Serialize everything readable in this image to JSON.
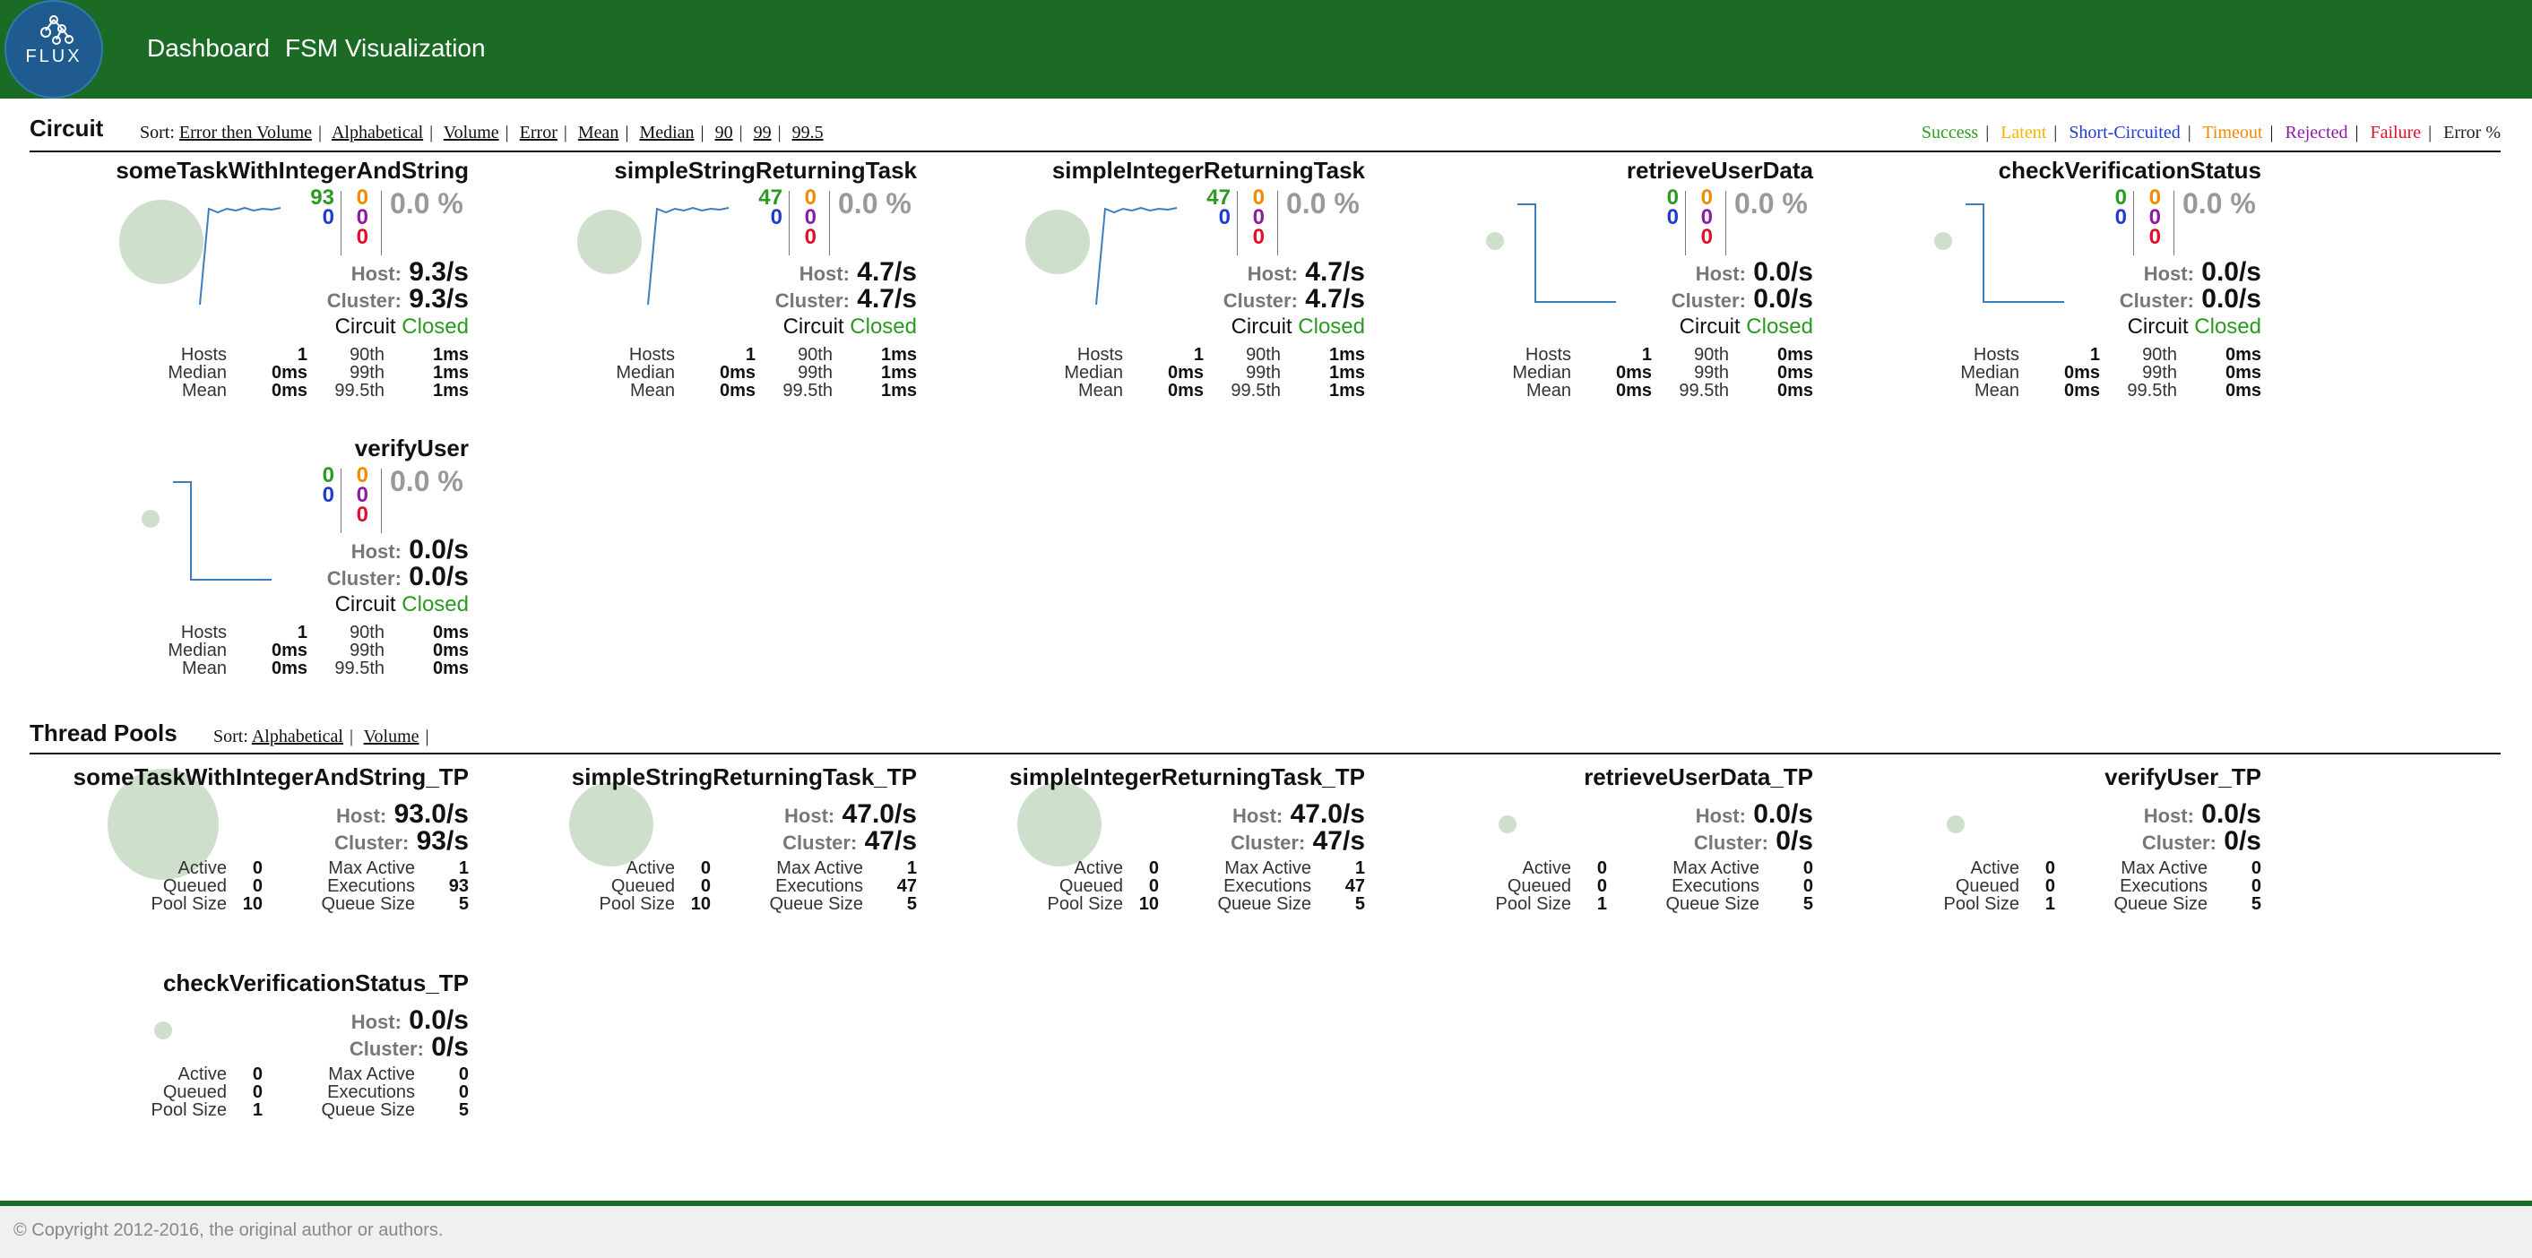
{
  "header": {
    "logo_text": "FLUX",
    "nav": [
      "Dashboard",
      "FSM Visualization"
    ]
  },
  "circuit": {
    "title": "Circuit",
    "sort_label": "Sort:",
    "sort_options": [
      "Error then Volume",
      "Alphabetical",
      "Volume",
      "Error",
      "Mean",
      "Median",
      "90",
      "99",
      "99.5"
    ],
    "legend": [
      {
        "label": "Success",
        "color": "#2a9a20"
      },
      {
        "label": "Latent",
        "color": "#f4b400"
      },
      {
        "label": "Short-Circuited",
        "color": "#1f3dcc"
      },
      {
        "label": "Timeout",
        "color": "#f08a00"
      },
      {
        "label": "Rejected",
        "color": "#8b1fa3"
      },
      {
        "label": "Failure",
        "color": "#e0102a"
      },
      {
        "label": "Error %",
        "color": "#222222"
      }
    ],
    "cards": [
      {
        "name": "someTaskWithIntegerAndString",
        "success": "93",
        "short": "0",
        "timeout": "0",
        "rejected": "0",
        "failure": "0",
        "error_pct": "0.0 %",
        "host": "9.3/s",
        "cluster": "9.3/s",
        "status_prefix": "Circuit",
        "status": "Closed",
        "hosts": "1",
        "median": "0ms",
        "mean": "0ms",
        "p90": "1ms",
        "p99": "1ms",
        "p995": "1ms",
        "volume_level": 1.0,
        "spark": "flat-high"
      },
      {
        "name": "simpleStringReturningTask",
        "success": "47",
        "short": "0",
        "timeout": "0",
        "rejected": "0",
        "failure": "0",
        "error_pct": "0.0 %",
        "host": "4.7/s",
        "cluster": "4.7/s",
        "status_prefix": "Circuit",
        "status": "Closed",
        "hosts": "1",
        "median": "0ms",
        "mean": "0ms",
        "p90": "1ms",
        "p99": "1ms",
        "p995": "1ms",
        "volume_level": 0.5,
        "spark": "flat-high"
      },
      {
        "name": "simpleIntegerReturningTask",
        "success": "47",
        "short": "0",
        "timeout": "0",
        "rejected": "0",
        "failure": "0",
        "error_pct": "0.0 %",
        "host": "4.7/s",
        "cluster": "4.7/s",
        "status_prefix": "Circuit",
        "status": "Closed",
        "hosts": "1",
        "median": "0ms",
        "mean": "0ms",
        "p90": "1ms",
        "p99": "1ms",
        "p995": "1ms",
        "volume_level": 0.5,
        "spark": "flat-high"
      },
      {
        "name": "retrieveUserData",
        "success": "0",
        "short": "0",
        "timeout": "0",
        "rejected": "0",
        "failure": "0",
        "error_pct": "0.0 %",
        "host": "0.0/s",
        "cluster": "0.0/s",
        "status_prefix": "Circuit",
        "status": "Closed",
        "hosts": "1",
        "median": "0ms",
        "mean": "0ms",
        "p90": "0ms",
        "p99": "0ms",
        "p995": "0ms",
        "volume_level": 0.0,
        "spark": "drop"
      },
      {
        "name": "checkVerificationStatus",
        "success": "0",
        "short": "0",
        "timeout": "0",
        "rejected": "0",
        "failure": "0",
        "error_pct": "0.0 %",
        "host": "0.0/s",
        "cluster": "0.0/s",
        "status_prefix": "Circuit",
        "status": "Closed",
        "hosts": "1",
        "median": "0ms",
        "mean": "0ms",
        "p90": "0ms",
        "p99": "0ms",
        "p995": "0ms",
        "volume_level": 0.0,
        "spark": "drop"
      },
      {
        "name": "verifyUser",
        "success": "0",
        "short": "0",
        "timeout": "0",
        "rejected": "0",
        "failure": "0",
        "error_pct": "0.0 %",
        "host": "0.0/s",
        "cluster": "0.0/s",
        "status_prefix": "Circuit",
        "status": "Closed",
        "hosts": "1",
        "median": "0ms",
        "mean": "0ms",
        "p90": "0ms",
        "p99": "0ms",
        "p995": "0ms",
        "volume_level": 0.0,
        "spark": "drop"
      }
    ],
    "labels": {
      "host": "Host:",
      "cluster": "Cluster:",
      "hosts": "Hosts",
      "median": "Median",
      "mean": "Mean",
      "p90": "90th",
      "p99": "99th",
      "p995": "99.5th"
    }
  },
  "thread_pools": {
    "title": "Thread Pools",
    "sort_label": "Sort:",
    "sort_options": [
      "Alphabetical",
      "Volume"
    ],
    "labels": {
      "host": "Host:",
      "cluster": "Cluster:",
      "active": "Active",
      "queued": "Queued",
      "pool_size": "Pool Size",
      "max_active": "Max Active",
      "executions": "Executions",
      "queue_size": "Queue Size"
    },
    "pools": [
      {
        "name": "someTaskWithIntegerAndString_TP",
        "host": "93.0/s",
        "cluster": "93/s",
        "active": "0",
        "queued": "0",
        "pool_size": "10",
        "max_active": "1",
        "executions": "93",
        "queue_size": "5",
        "volume_level": 1.0
      },
      {
        "name": "simpleStringReturningTask_TP",
        "host": "47.0/s",
        "cluster": "47/s",
        "active": "0",
        "queued": "0",
        "pool_size": "10",
        "max_active": "1",
        "executions": "47",
        "queue_size": "5",
        "volume_level": 0.5
      },
      {
        "name": "simpleIntegerReturningTask_TP",
        "host": "47.0/s",
        "cluster": "47/s",
        "active": "0",
        "queued": "0",
        "pool_size": "10",
        "max_active": "1",
        "executions": "47",
        "queue_size": "5",
        "volume_level": 0.5
      },
      {
        "name": "retrieveUserData_TP",
        "host": "0.0/s",
        "cluster": "0/s",
        "active": "0",
        "queued": "0",
        "pool_size": "1",
        "max_active": "0",
        "executions": "0",
        "queue_size": "5",
        "volume_level": 0.0
      },
      {
        "name": "verifyUser_TP",
        "host": "0.0/s",
        "cluster": "0/s",
        "active": "0",
        "queued": "0",
        "pool_size": "1",
        "max_active": "0",
        "executions": "0",
        "queue_size": "5",
        "volume_level": 0.0
      },
      {
        "name": "checkVerificationStatus_TP",
        "host": "0.0/s",
        "cluster": "0/s",
        "active": "0",
        "queued": "0",
        "pool_size": "1",
        "max_active": "0",
        "executions": "0",
        "queue_size": "5",
        "volume_level": 0.0
      }
    ]
  },
  "footer": {
    "copyright": "© Copyright 2012-2016, the original author or authors."
  }
}
